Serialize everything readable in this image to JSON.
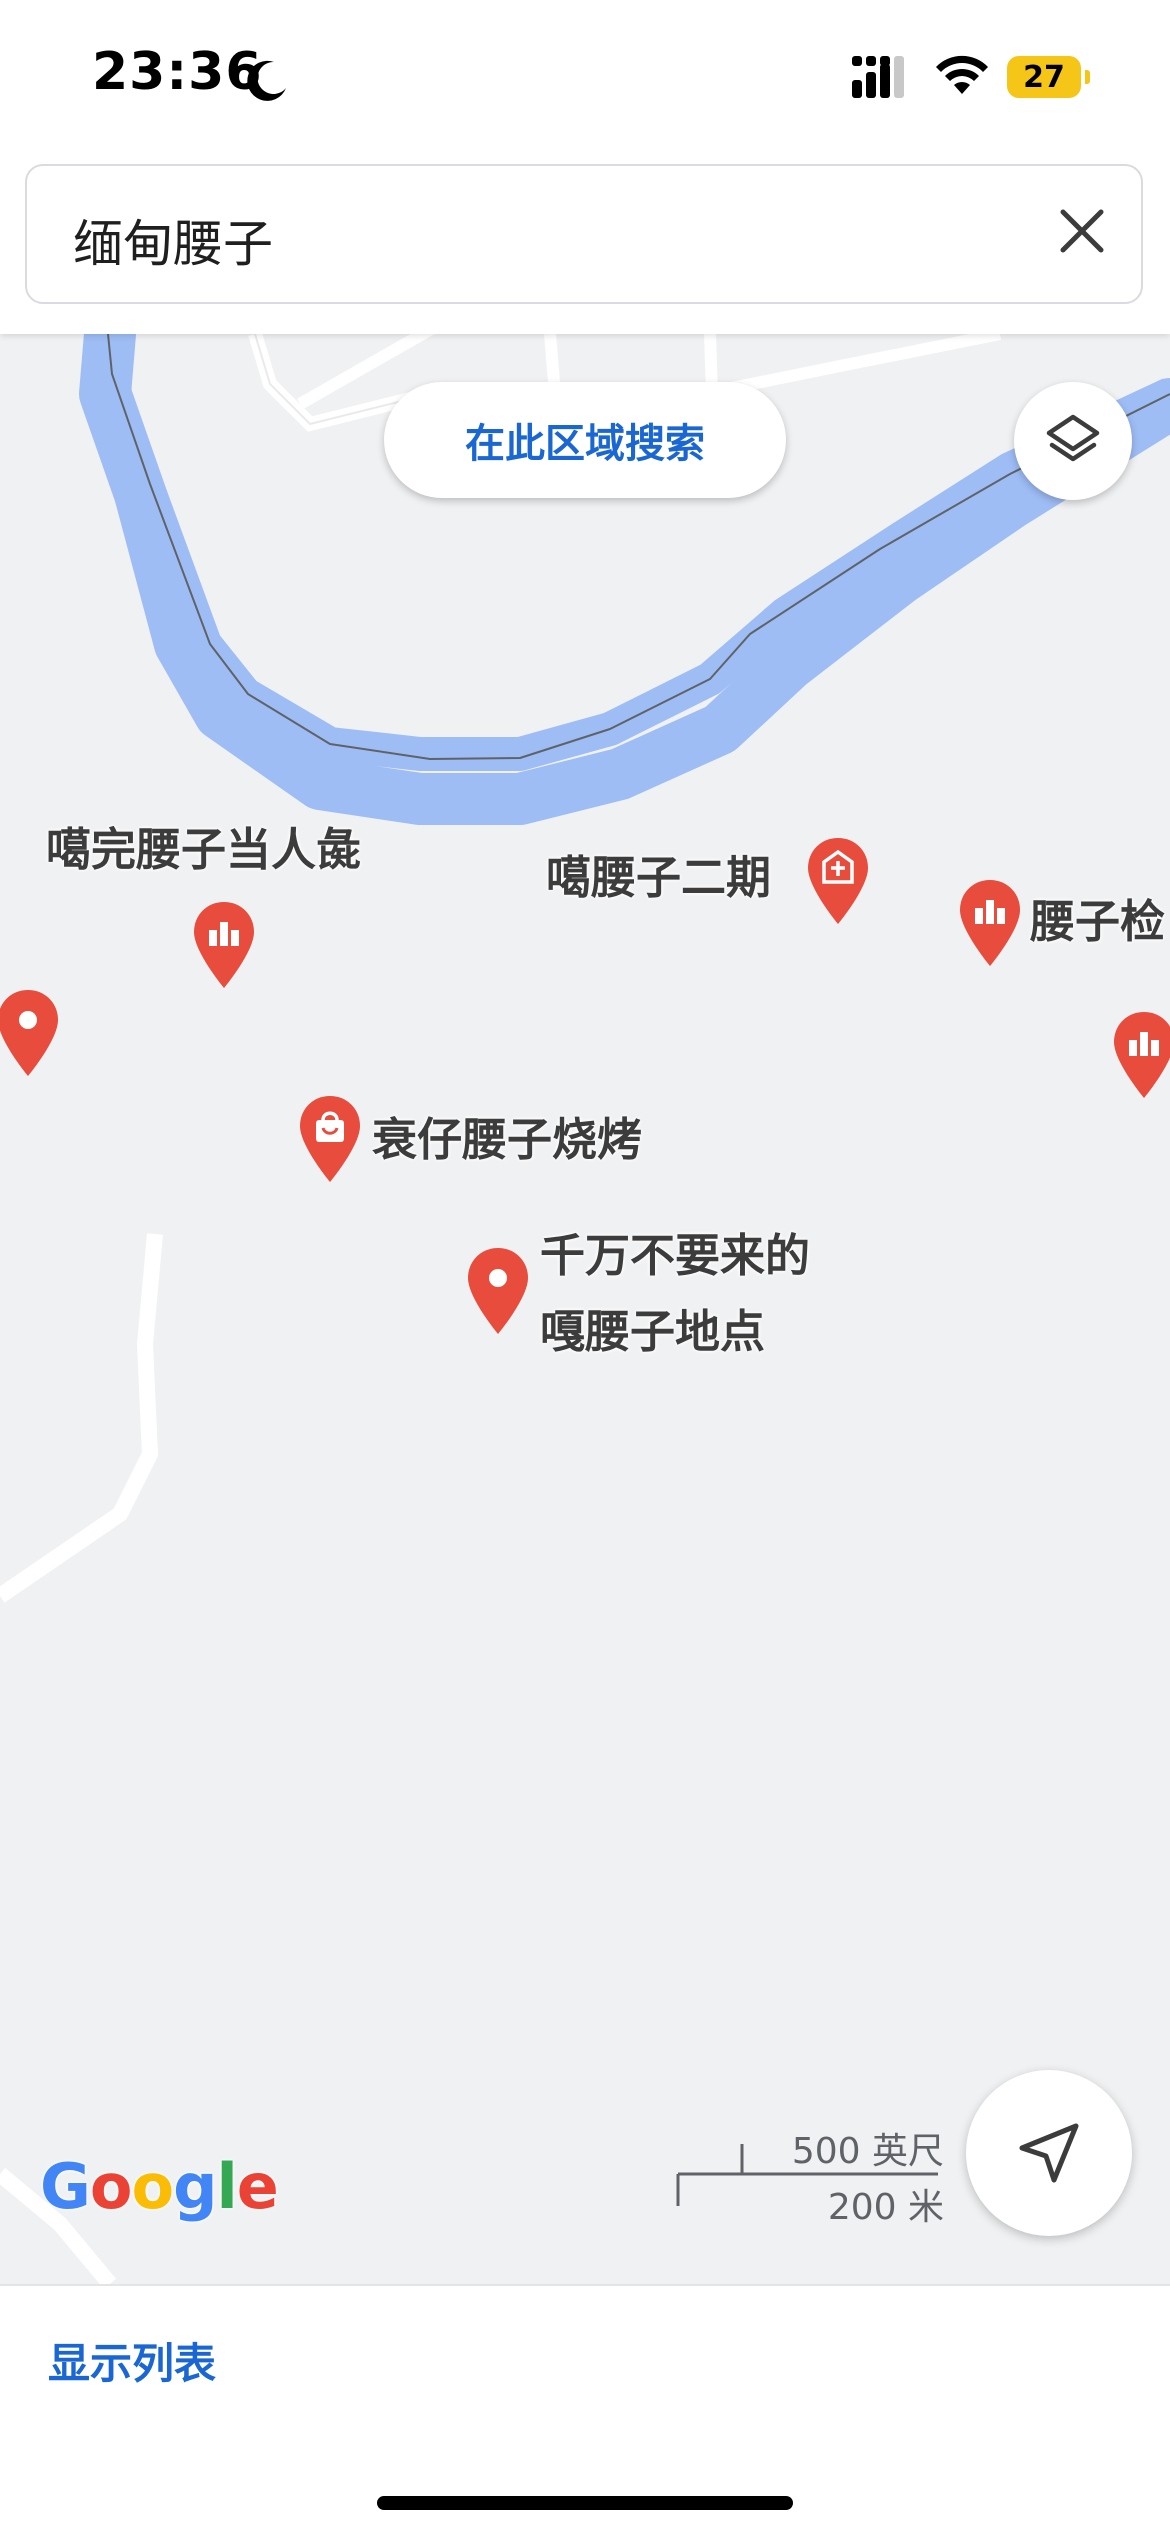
{
  "status_bar": {
    "time": "23:36",
    "battery_level": "27",
    "icons": [
      "moon-icon",
      "signal-icon",
      "wifi-icon",
      "battery-icon"
    ]
  },
  "search": {
    "query": "缅甸腰子",
    "clear_icon": "close-icon"
  },
  "map": {
    "search_area_button": "在此区域搜索",
    "layers_icon": "layers-icon",
    "locate_icon": "navigation-arrow-icon",
    "places": [
      {
        "label": "噶完腰子当人彘",
        "icon": "attraction-pin-icon"
      },
      {
        "label": "噶腰子二期",
        "icon": "hospital-pin-icon"
      },
      {
        "label": "腰子检",
        "icon": "attraction-pin-icon"
      },
      {
        "label": "衰仔腰子烧烤",
        "icon": "shopping-pin-icon"
      },
      {
        "label_line1": "千万不要来的",
        "label_line2": "嘎腰子地点",
        "icon": "generic-pin-icon"
      }
    ],
    "scale": {
      "imperial": "500 英尺",
      "metric": "200 米"
    },
    "attribution": {
      "letters": [
        "G",
        "o",
        "o",
        "g",
        "l",
        "e"
      ],
      "colors": [
        "#4285F4",
        "#EA4335",
        "#FBBC05",
        "#4285F4",
        "#34A853",
        "#EA4335"
      ]
    },
    "colors": {
      "pin": "#e74c3c",
      "river": "#9ebdf5",
      "accent": "#1a66d2"
    }
  },
  "bottom_sheet": {
    "show_list": "显示列表"
  }
}
